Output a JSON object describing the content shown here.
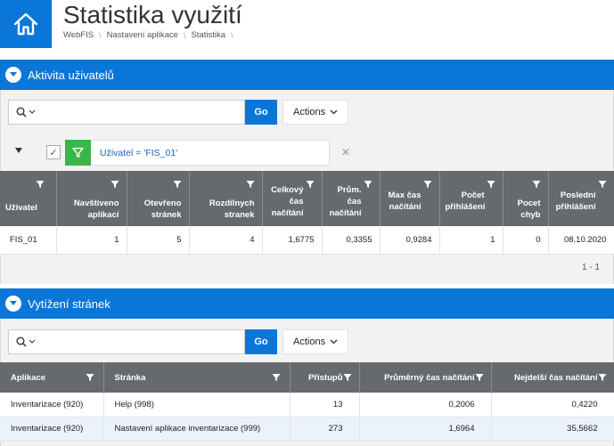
{
  "page": {
    "title": "Statistika využití",
    "breadcrumb": [
      "WebFIS",
      "Nastavení aplikace",
      "Statistika"
    ]
  },
  "region1": {
    "title": "Aktivita uživatelů",
    "search": {
      "value": "",
      "placeholder": ""
    },
    "go_label": "Go",
    "actions_label": "Actions",
    "filter": {
      "text": "Uživatel = 'FIS_01'"
    },
    "columns": [
      "Uživatel",
      "Navštíveno aplikací",
      "Otevřeno stránek",
      "Rozdílnych stranek",
      "Celkový čas načítání",
      "Prům. čas načítání",
      "Max čas načítání",
      "Počet přihlášení",
      "Pocet chyb",
      "Poslední přihlášení"
    ],
    "rows": [
      [
        "FIS_01",
        "1",
        "5",
        "4",
        "1,6775",
        "0,3355",
        "0,9284",
        "1",
        "0",
        "08.10.2020"
      ]
    ],
    "pagination": "1 - 1"
  },
  "region2": {
    "title": "Vytížení stránek",
    "search": {
      "value": "",
      "placeholder": ""
    },
    "go_label": "Go",
    "actions_label": "Actions",
    "columns": [
      "Aplikace",
      "Stránka",
      "Přístupů",
      "Průměrný čas načítání",
      "Nejdelší čas načítání"
    ],
    "rows": [
      [
        "Inventarizace (920)",
        "Help (998)",
        "13",
        "0,2006",
        "0,4220"
      ],
      [
        "Inventarizace (920)",
        "Nastavení aplikace inventarizace (999)",
        "273",
        "1,6964",
        "35,5662"
      ]
    ]
  },
  "colors": {
    "accent": "#0a76d8",
    "header_bg": "#666a6e",
    "filter_green": "#3bb546"
  }
}
